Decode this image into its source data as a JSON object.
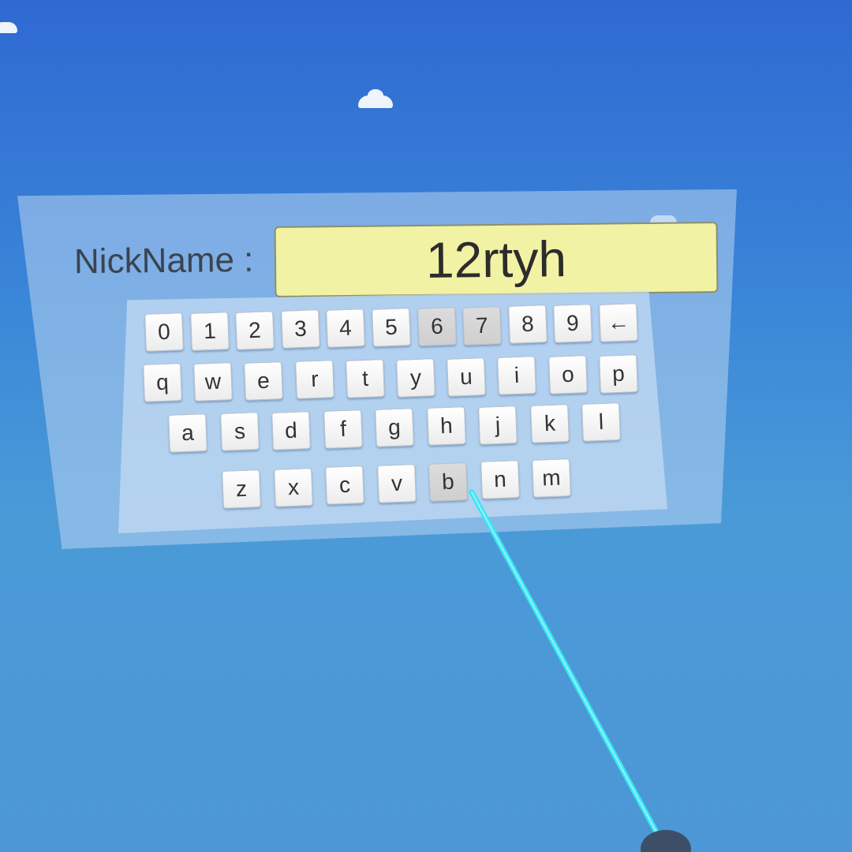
{
  "colors": {
    "sky_top": "#2f69d2",
    "sky_bottom": "#4d97d6",
    "input_background": "#f2f2a4",
    "laser": "#38e6f2"
  },
  "form": {
    "label": "NickName :",
    "value": "12rtyh"
  },
  "keyboard": {
    "rows": [
      [
        "0",
        "1",
        "2",
        "3",
        "4",
        "5",
        "6",
        "7",
        "8",
        "9",
        "←"
      ],
      [
        "q",
        "w",
        "e",
        "r",
        "t",
        "y",
        "u",
        "i",
        "o",
        "p"
      ],
      [
        "a",
        "s",
        "d",
        "f",
        "g",
        "h",
        "j",
        "k",
        "l"
      ],
      [
        "z",
        "x",
        "c",
        "v",
        "b",
        "n",
        "m"
      ]
    ],
    "pointer_target": "b"
  }
}
